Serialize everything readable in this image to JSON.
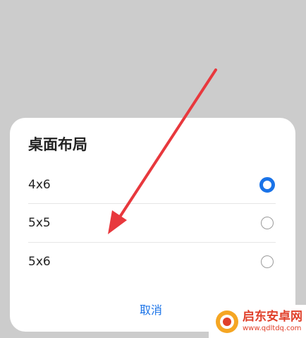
{
  "dialog": {
    "title": "桌面布局",
    "options": [
      {
        "label": "4x6",
        "selected": true
      },
      {
        "label": "5x5",
        "selected": false
      },
      {
        "label": "5x6",
        "selected": false
      }
    ],
    "cancel_label": "取消"
  },
  "colors": {
    "accent": "#1a73e8",
    "annotation_arrow": "#e8383d",
    "overlay": "#cccccc"
  },
  "watermark": {
    "title": "启东安卓网",
    "url": "www.qdltdq.com"
  }
}
